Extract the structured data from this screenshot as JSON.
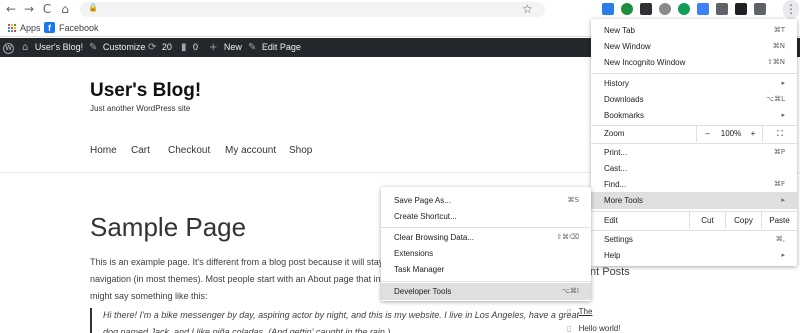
{
  "browser": {
    "nav": {
      "back": "←",
      "forward": "→",
      "reload": "C",
      "home": "⌂"
    },
    "lock_icon": "🔒",
    "star_icon": "☆",
    "menu_icon": "⋮",
    "extensions": [
      "#2b7de9",
      "#1e8e3e",
      "#303134",
      "#8a8a8a",
      "#0f9d58",
      "#3b82f6",
      "#5f6368",
      "#202124",
      "#5f6368"
    ]
  },
  "bookmarks": {
    "apps": "Apps",
    "facebook": "Facebook",
    "fb_letter": "f"
  },
  "adminbar": {
    "wp_logo": "W",
    "site": "User's Blog!",
    "customize": "Customize",
    "updates": "20",
    "comments": "0",
    "new": "New",
    "edit": "Edit Page",
    "icons": {
      "home": "⌂",
      "brush": "✎",
      "refresh": "⟳",
      "comment": "▮",
      "plus": "+",
      "pencil": "✎"
    }
  },
  "site": {
    "title": "User's Blog!",
    "tagline": "Just another WordPress site",
    "nav": [
      "Home",
      "Cart",
      "Checkout",
      "My account",
      "Shop"
    ]
  },
  "page": {
    "title": "Sample Page",
    "para1_line1": "This is an example page. It's different from a blog post because it will stay in",
    "para1_line2": "navigation (in most themes). Most people start with an About page that intro",
    "para1_line3": "might say something like this:",
    "quote_line1": "Hi there! I'm a bike messenger by day, aspiring actor by night, and this is my website. I live in Los Angeles, have a great",
    "quote_line2": "dog named Jack, and I like piña coladas. (And gettin' caught in the rain.)"
  },
  "sidebar": {
    "recent_title": "nt Posts",
    "items": [
      "The",
      "Hello world!"
    ],
    "doc_icon": "▯"
  },
  "chrome_menu": {
    "new_tab": "New Tab",
    "new_tab_sc": "⌘T",
    "new_window": "New Window",
    "new_window_sc": "⌘N",
    "incognito": "New Incognito Window",
    "incognito_sc": "⇧⌘N",
    "history": "History",
    "downloads": "Downloads",
    "downloads_sc": "⌥⌘L",
    "bookmarks": "Bookmarks",
    "zoom": "Zoom",
    "zoom_minus": "–",
    "zoom_value": "100%",
    "zoom_plus": "+",
    "fullscreen": "⛶",
    "print": "Print...",
    "print_sc": "⌘P",
    "cast": "Cast...",
    "find": "Find...",
    "find_sc": "⌘F",
    "more_tools": "More Tools",
    "edit": "Edit",
    "cut": "Cut",
    "copy": "Copy",
    "paste": "Paste",
    "settings": "Settings",
    "settings_sc": "⌘,",
    "help": "Help",
    "arrow": "▸"
  },
  "submenu": {
    "save_page": "Save Page As...",
    "save_page_sc": "⌘S",
    "create_shortcut": "Create Shortcut...",
    "clear_data": "Clear Browsing Data...",
    "clear_data_sc": "⇧⌘⌫",
    "extensions": "Extensions",
    "task_manager": "Task Manager",
    "dev_tools": "Developer Tools",
    "dev_tools_sc": "⌥⌘I"
  }
}
